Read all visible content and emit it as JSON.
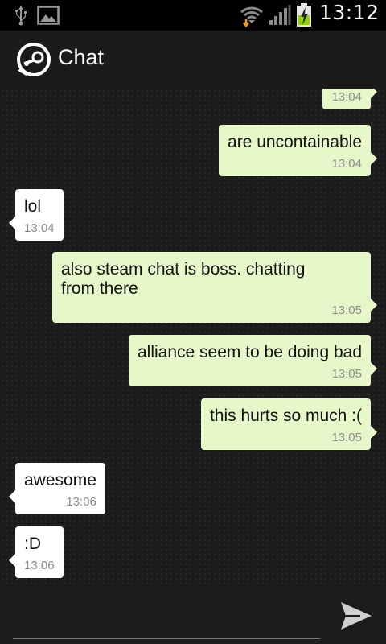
{
  "status_bar": {
    "time": "13:12",
    "icons": [
      "usb-icon",
      "image-icon",
      "wifi-icon",
      "signal-icon",
      "battery-charging-icon"
    ]
  },
  "app_bar": {
    "title": "Chat",
    "logo": "steam-logo-icon"
  },
  "messages": [
    {
      "direction": "out",
      "text": "",
      "time": "13:04"
    },
    {
      "direction": "out",
      "text": "are uncontainable",
      "time": "13:04"
    },
    {
      "direction": "in",
      "text": "lol",
      "time": "13:04"
    },
    {
      "direction": "out",
      "text": "also steam chat is boss. chatting\nfrom there",
      "time": "13:05"
    },
    {
      "direction": "out",
      "text": "alliance seem to be doing bad",
      "time": "13:05"
    },
    {
      "direction": "out",
      "text": "this hurts so much :(",
      "time": "13:05"
    },
    {
      "direction": "in",
      "text": "awesome",
      "time": "13:06"
    },
    {
      "direction": "in",
      "text": ":D",
      "time": "13:06"
    }
  ],
  "input": {
    "value": "",
    "placeholder": "",
    "send_icon": "send-icon"
  },
  "colors": {
    "outgoing_bubble": "#e6f8c9",
    "incoming_bubble": "#ffffff",
    "chat_background": "#1c1c1c"
  }
}
